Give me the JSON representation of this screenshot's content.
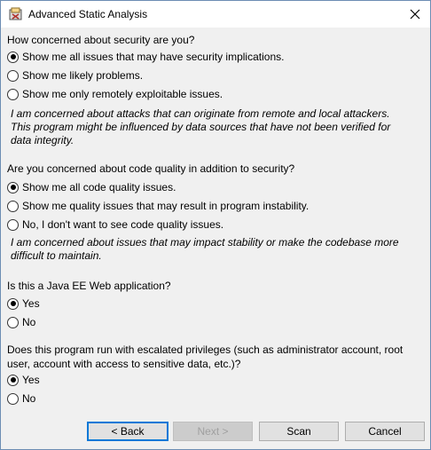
{
  "window": {
    "title": "Advanced Static Analysis"
  },
  "q1": {
    "question": "How concerned about security are you?",
    "options": [
      {
        "label": "Show me all issues that may have security implications.",
        "checked": true
      },
      {
        "label": "Show me likely problems.",
        "checked": false
      },
      {
        "label": "Show me only remotely exploitable issues.",
        "checked": false
      }
    ],
    "note": "I am concerned about attacks that can originate from remote and local attackers. This program might be influenced by data sources that have not been verified for data integrity."
  },
  "q2": {
    "question": "Are you concerned about code quality in addition to security?",
    "options": [
      {
        "label": "Show me all code quality issues.",
        "checked": true
      },
      {
        "label": "Show me quality issues that may result in program instability.",
        "checked": false
      },
      {
        "label": "No, I don't want to see code quality issues.",
        "checked": false
      }
    ],
    "note": "I am concerned about issues that may impact stability or make the codebase more difficult to maintain."
  },
  "q3": {
    "question": "Is this a Java EE Web application?",
    "options": [
      {
        "label": "Yes",
        "checked": true
      },
      {
        "label": "No",
        "checked": false
      }
    ]
  },
  "q4": {
    "question": "Does this program run with escalated privileges (such as administrator account, root user, account with access to sensitive data, etc.)?",
    "options": [
      {
        "label": "Yes",
        "checked": true
      },
      {
        "label": "No",
        "checked": false
      }
    ]
  },
  "buttons": {
    "back": "< Back",
    "next": "Next >",
    "scan": "Scan",
    "cancel": "Cancel"
  },
  "colors": {
    "default_button_border": "#0078d7",
    "background": "#f0f0f0"
  }
}
